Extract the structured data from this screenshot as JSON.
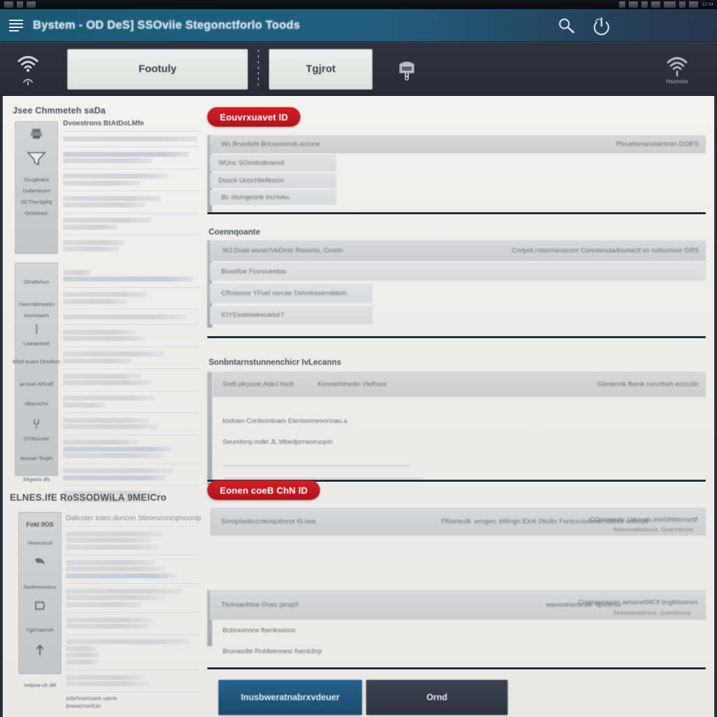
{
  "os_bar": {
    "left_items": [
      "app-chip",
      "app-chip",
      "app-chip"
    ],
    "right_items": [
      "tray-chip",
      "tray-chip",
      "tray-chip",
      "tray-chip",
      "tray-chip",
      "tray-chip",
      "tray-chip"
    ],
    "clock": "12:34"
  },
  "titlebar": {
    "menu_icon": "hamburger-icon",
    "title": "Bystem - OD DeS] SSOviie Stegonctforlo Toods",
    "actions": [
      {
        "name": "search-icon",
        "glyph": "search"
      },
      {
        "name": "power-icon",
        "glyph": "power"
      }
    ]
  },
  "toolbar": {
    "left_icon": "wifi-icon",
    "tabs": [
      {
        "label": "Footuly"
      },
      {
        "label": "Tgjrot"
      }
    ],
    "device_icon": "device-icon",
    "right_icon": {
      "name": "fingerprint-icon",
      "caption": "Hsonnio"
    }
  },
  "sidebar": {
    "cards": [
      {
        "title": "Jsee Chmmeteh saDa",
        "rail": {
          "items": [
            {
              "icon": "printer-icon",
              "label": ""
            },
            {
              "icon": "funnel-icon",
              "label": ""
            },
            {
              "icon": "",
              "label": "Ssugitrans"
            },
            {
              "icon": "",
              "label": "Dobertesen"
            },
            {
              "icon": "",
              "label": "DCThenbphtj"
            },
            {
              "icon": "",
              "label": "Ocleiioser"
            }
          ]
        },
        "list": {
          "header": "Dvoestrons BtAtDoLMfe",
          "rows": [
            {
              "lines": [
                "wide",
                "none"
              ]
            },
            {
              "lines": [
                "wide",
                "mid"
              ]
            },
            {
              "lines": [
                "mid",
                "mid"
              ]
            },
            {
              "lines": [
                "mid",
                "mid"
              ]
            },
            {
              "lines": [
                "mid",
                "short"
              ]
            },
            {
              "lines": [
                "short",
                "short"
              ]
            }
          ]
        }
      },
      {
        "title": "",
        "rail": {
          "items": [
            {
              "icon": "",
              "label": "Dtnattxhun"
            },
            {
              "icon": "",
              "label": "Yxwcrdetnwetcr"
            },
            {
              "icon": "",
              "label": "Arwnxaern"
            },
            {
              "icon": "bar-icon",
              "label": "Laaoaotnet"
            },
            {
              "icon": "",
              "label": "blitef buant Dtreiforn"
            },
            {
              "icon": "",
              "label": "acvoan AfSnitf"
            },
            {
              "icon": "",
              "label": "rMannchn"
            },
            {
              "icon": "plug-icon",
              "label": "OTtlGiuser"
            },
            {
              "icon": "",
              "label": "onosan Teojm"
            },
            {
              "icon": "",
              "label": "3Agasts dls"
            }
          ]
        },
        "list": {
          "header": "",
          "rows": [
            {
              "lines": [
                "wide",
                "mid"
              ]
            },
            {
              "lines": [
                "mid",
                "short"
              ]
            },
            {
              "lines": [
                "wide",
                "none"
              ]
            },
            {
              "lines": [
                "mid",
                "mid"
              ]
            },
            {
              "lines": [
                "mid",
                "short"
              ]
            },
            {
              "lines": [
                "mid",
                "mid"
              ]
            },
            {
              "lines": [
                "mid",
                "short"
              ]
            },
            {
              "lines": [
                "mid",
                "mid"
              ]
            },
            {
              "lines": [
                "wide",
                "mid"
              ]
            },
            {
              "lines": [
                "wide",
                "mid"
              ]
            },
            {
              "lines": [
                "mid",
                "mid"
              ]
            }
          ]
        }
      },
      {
        "title": "ELNES.IfE RoSSODWiLA 9MEICro",
        "rail": {
          "items": [
            {
              "icon": "",
              "label": "FokI 0OS"
            },
            {
              "icon": "",
              "label": "Vixwnxrcot"
            },
            {
              "icon": "bird-icon",
              "label": ""
            },
            {
              "icon": "",
              "label": "Nanhmmeeuv"
            },
            {
              "icon": "tag-icon",
              "label": ""
            },
            {
              "icon": "",
              "label": "Ygirtsaocon"
            },
            {
              "icon": "arrow-icon",
              "label": ""
            },
            {
              "icon": "",
              "label": "netpsw-ch.ditl"
            }
          ]
        },
        "list": {
          "header": "Dalicoter  Ioteo.duncnn        Stimesconcqmoonlp",
          "rows": [
            {
              "lines": [
                "mid",
                "mid",
                "mid"
              ]
            },
            {
              "lines": [
                "mid",
                "mid",
                "wide"
              ]
            },
            {
              "lines": [
                "wide",
                "mid",
                "short"
              ]
            },
            {
              "lines": [
                "mid",
                "mid"
              ]
            },
            {
              "lines": [
                "wide",
                "short",
                "short",
                "short"
              ]
            },
            {
              "lines": [
                "mid",
                "mid"
              ]
            }
          ],
          "footer": [
            "sxbrhnomsare uame",
            "bnewcrnerfcin"
          ]
        }
      }
    ]
  },
  "main": {
    "sections": [
      {
        "badge": "Eouvrxuavet lD",
        "rows": [
          {
            "text_left": "Wc Brucduht Bricooonnck.ocrune",
            "text_right": "Pfvuebsnanclaictmin DOlFS",
            "wide": true
          },
          {
            "text_left": "WUnc SOnottolbnenol",
            "wide": false
          },
          {
            "text_left": "Doock Uonchlleifeocin",
            "wide": false
          },
          {
            "text_left": "Bc otumgeonk Incriveu.",
            "wide": false
          }
        ]
      },
      {
        "label": "Coennqoante",
        "rows": [
          {
            "text_left": "WJ.Doail wsner/VeDmic Rooonis, Cmotn",
            "text_right": "Cmtpot.rntscrneusconr Conntonutadnunactt vn nofscmoor GRS",
            "wide": true
          },
          {
            "text_left": "Bowrlfoe Fovroueetoo",
            "wide": true
          },
          {
            "text_left": "CRoavoor YFuel sorcae Delvxkasernddoin",
            "wide": false
          },
          {
            "text_left": "IOYEsoonweecanul f",
            "wide": false
          }
        ]
      },
      {
        "label": "Sonbntarnstunnenchicr IvLecanns",
        "rows": [
          {
            "text_left": "Sndl,ollrpsoe.AdeJ hscti",
            "text_mid": "Kimnelrbhedin  Vlefhoor",
            "text_right": "Gbntennk fbenk concthoh eczcclin",
            "wide": true
          },
          {
            "text_left": "kodoen Cordsontoam Elentsomeoonnau.a",
            "wide": false
          },
          {
            "text_left": "Seundony.mdkt JL Mbedjorneoruopin",
            "wide": false
          }
        ]
      },
      {
        "badge": "Eonen coeB ChN lD",
        "rows": [
          {
            "text_left": "Simsplastinzcteoquttncot tS.boo",
            "text_mid": "Pfhorleufk .erngon: bWngn.fOnlt  Sficilln Fontcoutstonernottnor  onhnott",
            "text_right": "COnroeeetc Udcneto,tnoSthbtonorttf",
            "text_right_sub": "feonnontdoitroce, Guennfocns",
            "wide": true
          },
          {
            "text_left": "Tkrinsanhtoe  Ones ptrop!f",
            "text_mid": "wwnoohonontlli: ttpioersu",
            "text_right": "Cnspownason aesonet9tlOf tingtblsonon",
            "text_right_sub": "fonnsmnebfroce, Guenrfocns",
            "wide": true
          },
          {
            "text_left": "Bcbnxonorw fbenksonno",
            "wide": false
          },
          {
            "text_left": "Bronasdte Rnbfeennesr  fsenlcbrp",
            "wide": false
          }
        ]
      }
    ],
    "buttons": [
      {
        "label": "Inusbweratnabrxvdeuer",
        "style": "primary"
      },
      {
        "label": "Ornd",
        "style": "secondary"
      }
    ]
  },
  "colors": {
    "titlebar_start": "#1b5870",
    "titlebar_end": "#27364b",
    "toolbar": "#2d333d",
    "badge_red": "#c0191e",
    "primary_button": "#205579",
    "secondary_button": "#343b47",
    "page_background": "#ececeb",
    "rule": "#222831"
  }
}
